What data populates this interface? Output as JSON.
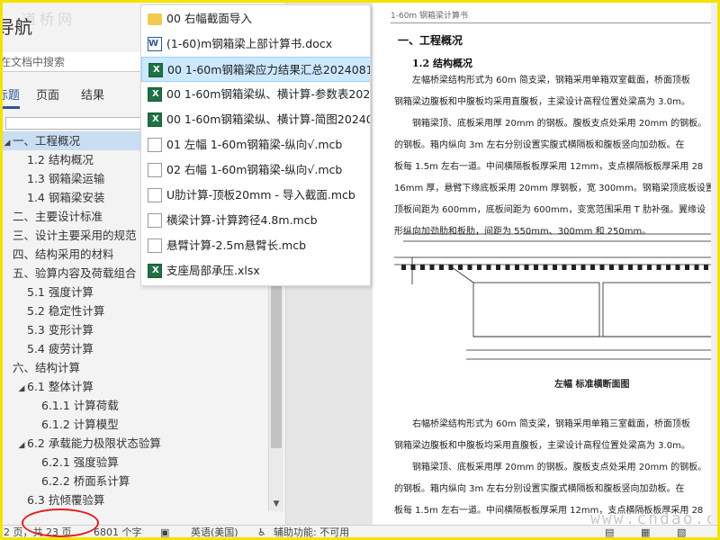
{
  "watermark_top": "道桥网",
  "watermark_bottom": "www.cndao.com",
  "nav": {
    "title": "导航",
    "search_placeholder": "在文档中搜索",
    "tabs": [
      {
        "label": "标题"
      },
      {
        "label": "页面"
      },
      {
        "label": "结果"
      }
    ],
    "headings": [
      {
        "level": 1,
        "caret": "◢",
        "text": "一、工程概况",
        "selected": true
      },
      {
        "level": 2,
        "caret": "",
        "text": "1.2 结构概况"
      },
      {
        "level": 2,
        "caret": "",
        "text": "1.3 钢箱梁运输"
      },
      {
        "level": 2,
        "caret": "",
        "text": "1.4 钢箱梁安装"
      },
      {
        "level": 1,
        "caret": "",
        "text": "二、主要设计标准"
      },
      {
        "level": 1,
        "caret": "",
        "text": "三、设计主要采用的规范"
      },
      {
        "level": 1,
        "caret": "",
        "text": "四、结构采用的材料"
      },
      {
        "level": 1,
        "caret": "",
        "text": "五、验算内容及荷载组合"
      },
      {
        "level": 2,
        "caret": "",
        "text": "5.1 强度计算"
      },
      {
        "level": 2,
        "caret": "",
        "text": "5.2 稳定性计算"
      },
      {
        "level": 2,
        "caret": "",
        "text": "5.3 变形计算"
      },
      {
        "level": 2,
        "caret": "",
        "text": "5.4 疲劳计算"
      },
      {
        "level": 1,
        "caret": "",
        "text": "六、结构计算"
      },
      {
        "level": 2,
        "caret": "◢",
        "text": "6.1 整体计算"
      },
      {
        "level": 3,
        "caret": "",
        "text": "6.1.1 计算荷载"
      },
      {
        "level": 3,
        "caret": "",
        "text": "6.1.2 计算模型"
      },
      {
        "level": 2,
        "caret": "◢",
        "text": "6.2 承载能力极限状态验算"
      },
      {
        "level": 3,
        "caret": "",
        "text": "6.2.1 强度验算"
      },
      {
        "level": 3,
        "caret": "",
        "text": "6.2.2 桥面系计算"
      },
      {
        "level": 2,
        "caret": "",
        "text": "6.3 抗倾覆验算"
      }
    ]
  },
  "files": [
    {
      "icon": "folder-icon",
      "type": "folder",
      "name": "00 右幅截面导入"
    },
    {
      "icon": "word-doc-icon",
      "type": "word",
      "name": "(1-60)m钢箱梁上部计算书.docx"
    },
    {
      "icon": "excel-file-icon",
      "type": "excel",
      "name": "00 1-60m钢箱梁应力结果汇总2024081...",
      "selected": true
    },
    {
      "icon": "excel-file-icon",
      "type": "excel",
      "name": "00 1-60m钢箱梁纵、横计算-参数表202..."
    },
    {
      "icon": "excel-file-icon",
      "type": "excel",
      "name": "00 1-60m钢箱梁纵、横计算-简图20240..."
    },
    {
      "icon": "mcb-file-icon",
      "type": "generic",
      "name": "01 左幅 1-60m钢箱梁-纵向√.mcb"
    },
    {
      "icon": "mcb-file-icon",
      "type": "generic",
      "name": "02 右幅 1-60m钢箱梁-纵向√.mcb"
    },
    {
      "icon": "mcb-file-icon",
      "type": "generic",
      "name": "U肋计算-顶板20mm - 导入截面.mcb"
    },
    {
      "icon": "mcb-file-icon",
      "type": "generic",
      "name": "横梁计算-计算跨径4.8m.mcb"
    },
    {
      "icon": "mcb-file-icon",
      "type": "generic",
      "name": "悬臂计算-2.5m悬臂长.mcb"
    },
    {
      "icon": "excel-file-icon",
      "type": "excel",
      "name": "支座局部承压.xlsx"
    }
  ],
  "document": {
    "header": "1-60m 钢箱梁计算书",
    "h1": "一、工程概况",
    "h2": "1.2 结构概况",
    "lines_top": [
      "　　左幅桥梁结构形式为 60m 简支梁，钢箱采用单箱双室截面，桥面顶板",
      "钢箱梁边腹板和中腹板均采用直腹板，主梁设计高程位置处梁高为 3.0m。",
      "　　钢箱梁顶、底板采用厚 20mm 的钢板。腹板支点处采用 20mm 的钢板。",
      "的钢板。箱内纵向 3m 左右分别设置实腹式横隔板和腹板竖向加劲板。在",
      "板每 1.5m 左右一道。中间横隔板板厚采用 12mm，支点横隔板板厚采用 28",
      "16mm 厚，悬臂下缘底板采用 20mm 厚钢板，宽 300mm。钢箱梁顶底板设置",
      "顶板间距为 600mm，底板间距为 600mm，变宽范围采用 T 肋补强。翼缘设",
      "形纵向加劲肋和板肋，间距为 550mm、300mm 和 250mm。"
    ],
    "caption": "左幅 标准横断面图",
    "lines_bottom": [
      "　　右幅桥梁结构形式为 60m 简支梁，钢箱采用单箱三室截面，桥面顶板",
      "钢箱梁边腹板和中腹板均采用直腹板，主梁设计高程位置处梁高为 3.0m。",
      "　　钢箱梁顶、底板采用厚 20mm 的钢板。腹板支点处采用 20mm 的钢板。",
      "的钢板。箱内纵向 3m 左右分别设置实腹式横隔板和腹板竖向加劲板。在",
      "板每 1.5m 左右一道。中间横隔板板厚采用 12mm，支点横隔板板厚采用 28"
    ]
  },
  "status": {
    "page": "2 页，共 23 页",
    "words": "6801 个字",
    "language": "英语(美国)",
    "accessibility": "辅助功能: 不可用"
  },
  "colors": {
    "frame": "#f2e400",
    "highlight_circle": "#e02020",
    "selected_heading": "#c9ddf3",
    "selected_file": "#cce8ff"
  }
}
